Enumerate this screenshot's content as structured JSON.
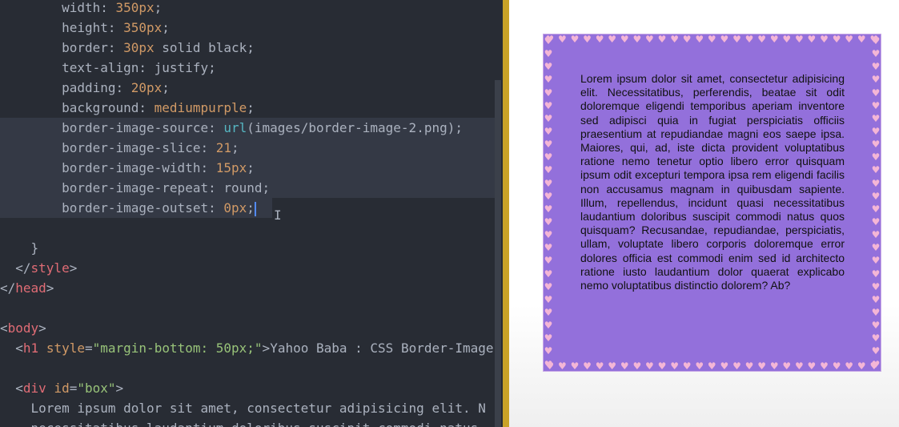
{
  "editor": {
    "lines": [
      {
        "indent": "        ",
        "prop": "width",
        "value": "350px"
      },
      {
        "indent": "        ",
        "prop": "height",
        "value": "350px"
      },
      {
        "indent": "        ",
        "prop": "border",
        "num": "30px",
        "rest": " solid black"
      },
      {
        "indent": "        ",
        "prop": "text-align",
        "rest": "justify"
      },
      {
        "indent": "        ",
        "prop": "padding",
        "value": "20px"
      },
      {
        "indent": "        ",
        "prop": "background",
        "kw": "mediumpurple"
      },
      {
        "indent": "        ",
        "prop": "border-image-source",
        "fn": "url",
        "arg": "(images/border-image-2.png)"
      },
      {
        "indent": "        ",
        "prop": "border-image-slice",
        "value": "21"
      },
      {
        "indent": "        ",
        "prop": "border-image-width",
        "value": "15px"
      },
      {
        "indent": "        ",
        "prop": "border-image-repeat",
        "rest": "round"
      },
      {
        "indent": "        ",
        "prop": "border-image-outset",
        "value": "0px"
      }
    ],
    "close_brace": "}",
    "style_close": "style",
    "head_close": "head",
    "body_open": "body",
    "h1_tag": "h1",
    "h1_attr": "style",
    "h1_attr_value": "\"margin-bottom: 50px;\"",
    "h1_text": "Yahoo Baba : CSS Border-Image",
    "div_tag": "div",
    "div_attr": "id",
    "div_attr_value": "\"box\"",
    "content_line1": "Lorem ipsum dolor sit amet, consectetur adipisicing elit. N",
    "content_line2": "necessitatibus laudantium doloribus suscipit commodi natus"
  },
  "preview": {
    "box_text": "Lorem ipsum dolor sit amet, consectetur adipisicing elit. Necessitatibus, perferendis, beatae sit odit doloremque eligendi temporibus aperiam inventore sed adipisci quia in fugiat perspiciatis officiis praesentium at repudiandae magni eos saepe ipsa. Maiores, qui, ad, iste dicta provident voluptatibus ratione nemo tenetur optio libero error quisquam ipsum odit excepturi tempora ipsa rem eligendi facilis non accusamus magnam in quibusdam sapiente. Illum, repellendus, incidunt quasi necessitatibus laudantium doloribus suscipit commodi natus quos quisquam? Recusandae, repudiandae, perspiciatis, ullam, voluptate libero corporis doloremque error dolores officia est commodi enim sed id architecto ratione iusto laudantium dolor quaerat explicabo nemo voluptatibus distinctio dolorem? Ab?",
    "box_background": "#9370db",
    "heart_color": "#f4b6d6"
  }
}
